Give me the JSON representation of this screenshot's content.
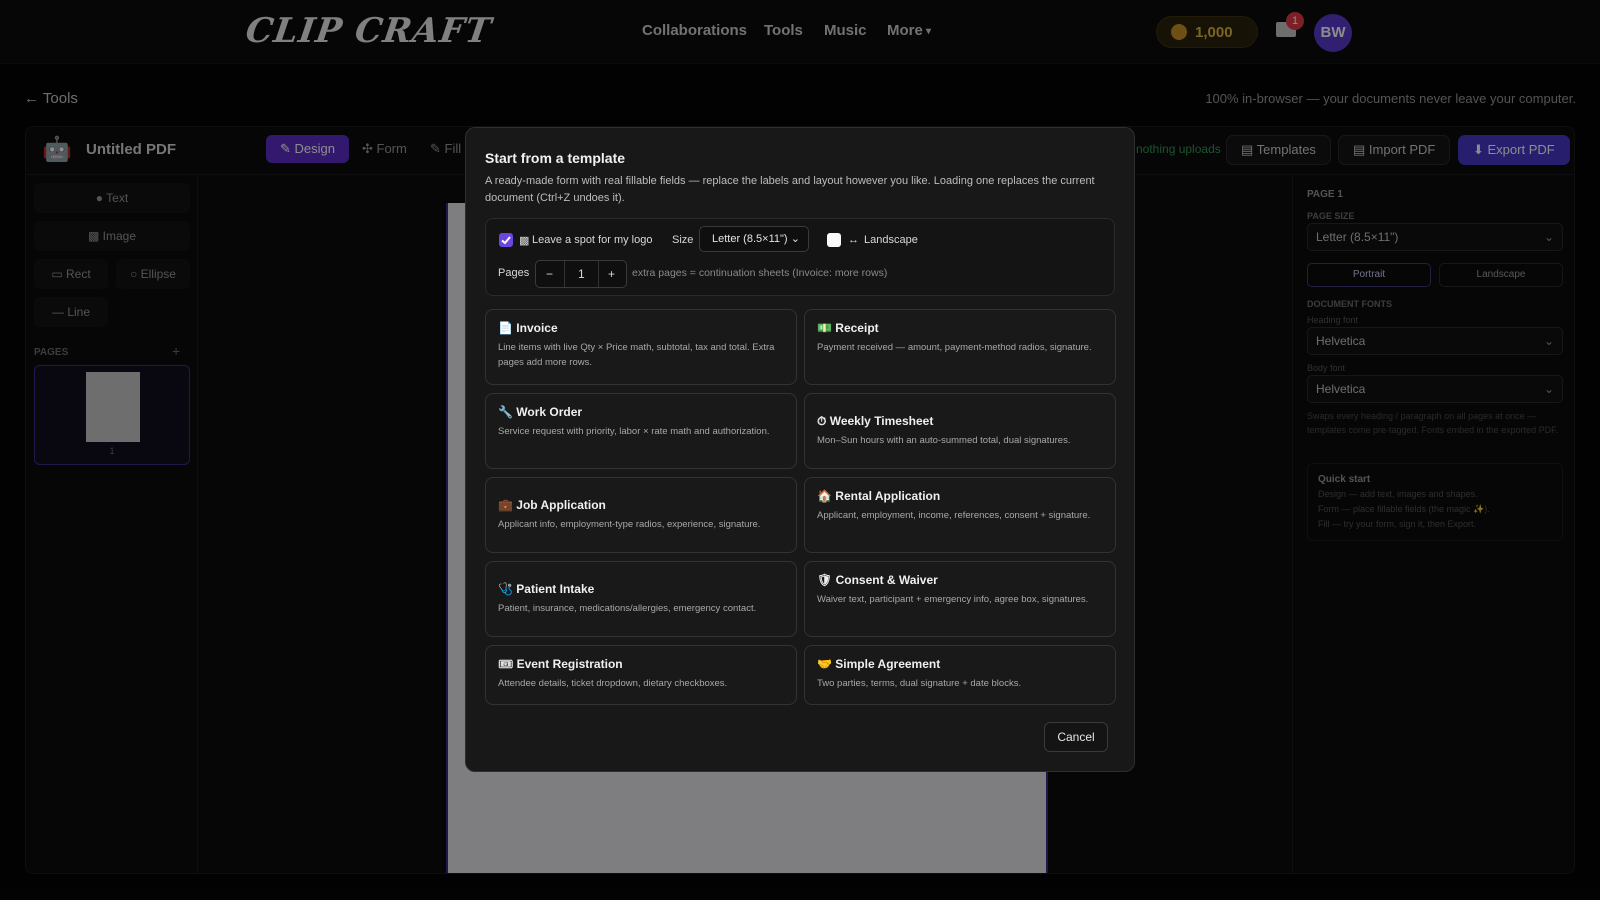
{
  "topbar": {
    "logo": "CLIP CRAFT",
    "nav": [
      "Collaborations",
      "Tools",
      "Music",
      "More"
    ],
    "coins": "1,000",
    "notifications": "1",
    "avatar": "BW"
  },
  "crumb": {
    "back": "← Tools",
    "privacy_note": "100% in-browser — your documents never leave your computer."
  },
  "editor": {
    "doc_title": "Untitled PDF",
    "tabs": [
      "Design",
      "Form",
      "Fill"
    ],
    "nothing_uploads": "nothing uploads",
    "templates_btn": "Templates",
    "import_btn": "Import PDF",
    "export_btn": "Export PDF",
    "tools": [
      "Text",
      "Image",
      "Rect",
      "Ellipse",
      "Line"
    ],
    "pages_label": "PAGES",
    "page_number": "1"
  },
  "right_panel": {
    "page_label": "PAGE 1",
    "page_size_label": "PAGE SIZE",
    "page_size": "Letter (8.5×11\")",
    "orientation": [
      "Portrait",
      "Landscape"
    ],
    "fonts_label": "DOCUMENT FONTS",
    "heading_font_label": "Heading font",
    "heading_font": "Helvetica",
    "body_font_label": "Body font",
    "body_font": "Helvetica",
    "fonts_hint": "Swaps every heading / paragraph on all pages at once — templates come pre-tagged. Fonts embed in the exported PDF.",
    "quick_start_title": "Quick start",
    "quick_start": [
      "Design — add text, images and shapes.",
      "Form — place fillable fields (the magic ✨).",
      "Fill — try your form, sign it, then Export."
    ]
  },
  "modal": {
    "title": "Start from a template",
    "description": "A ready-made form with real fillable fields — replace the labels and layout however you like. Loading one replaces the current document (Ctrl+Z undoes it).",
    "logo_spot_label": "Leave a spot for my logo",
    "size_label": "Size",
    "size_value": "Letter (8.5×11\")",
    "landscape_label": "Landscape",
    "pages_label": "Pages",
    "pages_value": "1",
    "pages_hint": "extra pages = continuation sheets (Invoice: more rows)",
    "cancel": "Cancel",
    "templates": [
      {
        "icon": "📄",
        "name": "Invoice",
        "desc": "Line items with live Qty × Price math, subtotal, tax and total. Extra pages add more rows."
      },
      {
        "icon": "💵",
        "name": "Receipt",
        "desc": "Payment received — amount, payment-method radios, signature."
      },
      {
        "icon": "🔧",
        "name": "Work Order",
        "desc": "Service request with priority, labor × rate math and authorization."
      },
      {
        "icon": "⏱",
        "name": "Weekly Timesheet",
        "desc": "Mon–Sun hours with an auto-summed total, dual signatures."
      },
      {
        "icon": "💼",
        "name": "Job Application",
        "desc": "Applicant info, employment-type radios, experience, signature."
      },
      {
        "icon": "🏠",
        "name": "Rental Application",
        "desc": "Applicant, employment, income, references, consent + signature."
      },
      {
        "icon": "🩺",
        "name": "Patient Intake",
        "desc": "Patient, insurance, medications/allergies, emergency contact."
      },
      {
        "icon": "🛡",
        "name": "Consent & Waiver",
        "desc": "Waiver text, participant + emergency info, agree box, signatures."
      },
      {
        "icon": "🎟",
        "name": "Event Registration",
        "desc": "Attendee details, ticket dropdown, dietary checkboxes."
      },
      {
        "icon": "🤝",
        "name": "Simple Agreement",
        "desc": "Two parties, terms, dual signature + date blocks."
      }
    ]
  },
  "colors": {
    "accent": "#5d2fc9",
    "export": "#4a38c8",
    "coin": "#e0b640",
    "notification": "#e23b49",
    "avatar": "#5a3bd0"
  }
}
